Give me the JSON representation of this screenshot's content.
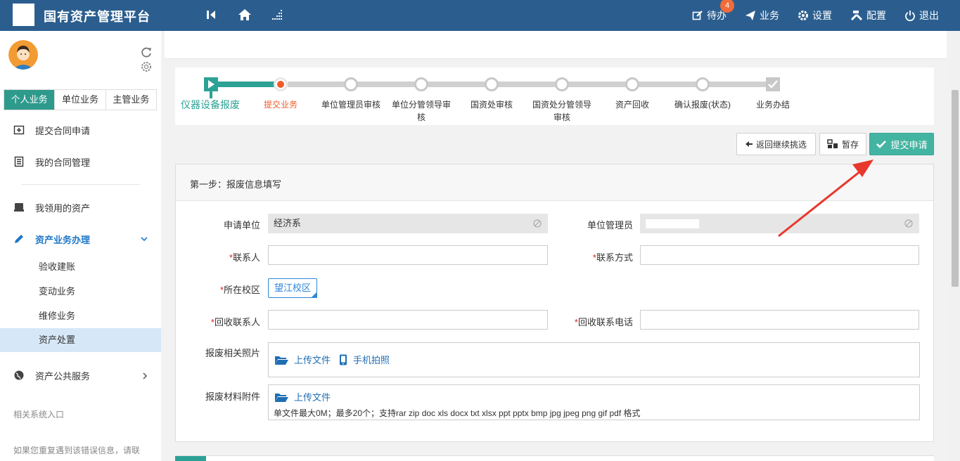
{
  "app": {
    "title": "国有资产管理平台"
  },
  "top_menu": [
    {
      "label": "待办",
      "icon": "edit-icon",
      "badge": "4"
    },
    {
      "label": "业务",
      "icon": "paper-plane-icon"
    },
    {
      "label": "设置",
      "icon": "gear-icon"
    },
    {
      "label": "配置",
      "icon": "tools-icon"
    },
    {
      "label": "退出",
      "icon": "power-icon"
    }
  ],
  "sidebar": {
    "tabs": [
      "个人业务",
      "单位业务",
      "主管业务"
    ],
    "active_tab": "个人业务",
    "items": [
      {
        "label": "提交合同申请",
        "icon": "plus-square-icon"
      },
      {
        "label": "我的合同管理",
        "icon": "list-icon"
      },
      {
        "label": "我领用的资产",
        "icon": "drive-icon"
      },
      {
        "label": "资产业务办理",
        "icon": "pencil-icon"
      },
      {
        "label": "资产公共服务",
        "icon": "globe-icon"
      }
    ],
    "sub_items": [
      "验收建账",
      "变动业务",
      "维修业务",
      "资产处置"
    ],
    "selected_sub": "资产处置",
    "footer_link": "相关系统入口",
    "footer_note": "如果您重复遇到该错误信息，请联"
  },
  "steps": [
    {
      "label": "仪器设备报废",
      "state": "done"
    },
    {
      "label": "提交业务",
      "state": "current"
    },
    {
      "label": "单位管理员审核",
      "state": "todo"
    },
    {
      "label": "单位分管领导审核",
      "state": "todo"
    },
    {
      "label": "国资处审核",
      "state": "todo"
    },
    {
      "label": "国资处分管领导审核",
      "state": "todo"
    },
    {
      "label": "资产回收",
      "state": "todo"
    },
    {
      "label": "确认报废(状态)",
      "state": "todo"
    },
    {
      "label": "业务办结",
      "state": "todo"
    }
  ],
  "actions": {
    "back_label": "返回继续挑选",
    "save_label": "暂存",
    "submit_label": "提交申请"
  },
  "form": {
    "panel_title": "第一步：报废信息填写",
    "apply_unit_label": "申请单位",
    "apply_unit_value": "经济系",
    "unit_admin_label": "单位管理员",
    "unit_admin_value": "",
    "contact_label": "联系人",
    "contact_value": "",
    "contact_phone_label": "联系方式",
    "contact_phone_value": "",
    "campus_label": "所在校区",
    "campus_value": "望江校区",
    "recycle_contact_label": "回收联系人",
    "recycle_contact_value": "",
    "recycle_phone_label": "回收联系电话",
    "recycle_phone_value": "",
    "photos_label": "报废相关照片",
    "upload_label": "上传文件",
    "phone_photo_label": "手机拍照",
    "attachments_label": "报废材料附件",
    "attach_upload_label": "上传文件",
    "attach_hint": "单文件最大0M；最多20个；支持rar zip doc xls docx txt xlsx ppt pptx bmp jpg jpeg png gif pdf 格式",
    "required_mark": "*"
  },
  "colors": {
    "topbar": "#2b5e8f",
    "accent": "#2e9a8c",
    "current_step": "#f05a28",
    "submit": "#44b4a2",
    "arrow": "#e8372c"
  }
}
